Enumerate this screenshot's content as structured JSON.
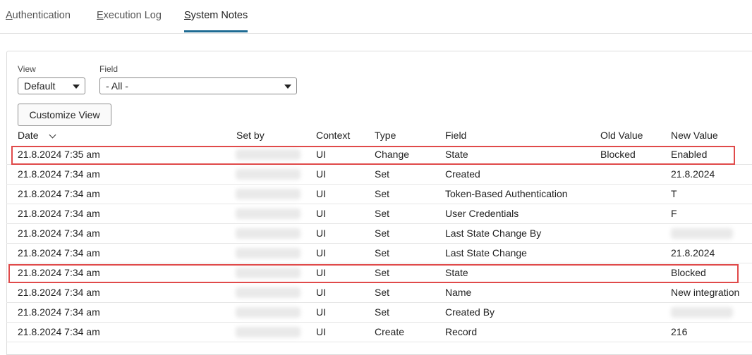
{
  "tabs": {
    "authentication": {
      "accel": "A",
      "rest": "uthentication"
    },
    "execution_log": {
      "accel": "E",
      "rest": "xecution Log"
    },
    "system_notes": {
      "accel": "S",
      "rest": "ystem Notes"
    }
  },
  "filters": {
    "view_label": "View",
    "view_value": "Default",
    "field_label": "Field",
    "field_value": "- All -"
  },
  "customize_button": "Customize View",
  "table": {
    "headers": [
      "Date",
      "Set by",
      "Context",
      "Type",
      "Field",
      "Old Value",
      "New Value"
    ],
    "rows": [
      {
        "date": "21.8.2024 7:35 am",
        "context": "UI",
        "type": "Change",
        "field": "State",
        "old": "Blocked",
        "new": "Enabled"
      },
      {
        "date": "21.8.2024 7:34 am",
        "context": "UI",
        "type": "Set",
        "field": "Created",
        "old": "",
        "new": "21.8.2024"
      },
      {
        "date": "21.8.2024 7:34 am",
        "context": "UI",
        "type": "Set",
        "field": "Token-Based Authentication",
        "old": "",
        "new": "T"
      },
      {
        "date": "21.8.2024 7:34 am",
        "context": "UI",
        "type": "Set",
        "field": "User Credentials",
        "old": "",
        "new": "F"
      },
      {
        "date": "21.8.2024 7:34 am",
        "context": "UI",
        "type": "Set",
        "field": "Last State Change By",
        "old": "",
        "new": ""
      },
      {
        "date": "21.8.2024 7:34 am",
        "context": "UI",
        "type": "Set",
        "field": "Last State Change",
        "old": "",
        "new": "21.8.2024"
      },
      {
        "date": "21.8.2024 7:34 am",
        "context": "UI",
        "type": "Set",
        "field": "State",
        "old": "",
        "new": "Blocked"
      },
      {
        "date": "21.8.2024 7:34 am",
        "context": "UI",
        "type": "Set",
        "field": "Name",
        "old": "",
        "new": "New integration"
      },
      {
        "date": "21.8.2024 7:34 am",
        "context": "UI",
        "type": "Set",
        "field": "Created By",
        "old": "",
        "new": ""
      },
      {
        "date": "21.8.2024 7:34 am",
        "context": "UI",
        "type": "Create",
        "field": "Record",
        "old": "",
        "new": "216"
      }
    ]
  },
  "highlight_color": "#e04a4a",
  "active_tab_color": "#1e6b93"
}
